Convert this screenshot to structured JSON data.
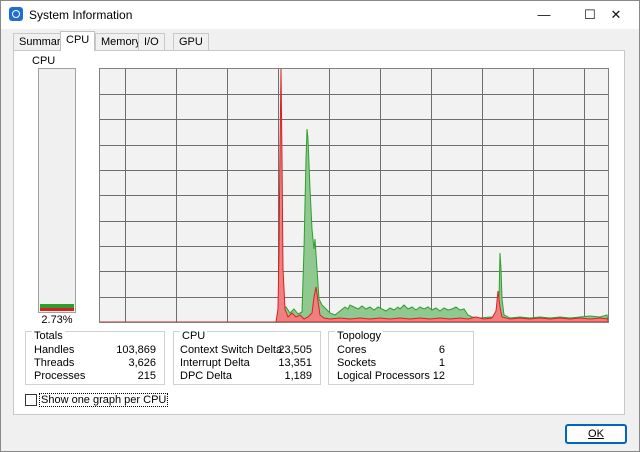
{
  "window": {
    "title": "System Information",
    "controls": {
      "minimize": "—",
      "maximize": "☐",
      "close": "✕"
    }
  },
  "tabs": [
    {
      "label": "Summary",
      "active": false
    },
    {
      "label": "CPU",
      "active": true
    },
    {
      "label": "Memory",
      "active": false
    },
    {
      "label": "I/O",
      "active": false
    },
    {
      "label": "GPU",
      "active": false
    }
  ],
  "cpu_meter": {
    "label": "CPU",
    "value_text": "2.73%",
    "value_fraction": 0.0273
  },
  "totals": {
    "title": "Totals",
    "rows": [
      {
        "label": "Handles",
        "value": "103,869"
      },
      {
        "label": "Threads",
        "value": "3,626"
      },
      {
        "label": "Processes",
        "value": "215"
      }
    ]
  },
  "cpu_stats": {
    "title": "CPU",
    "rows": [
      {
        "label": "Context Switch Delta",
        "value": "23,505"
      },
      {
        "label": "Interrupt Delta",
        "value": "13,351"
      },
      {
        "label": "DPC Delta",
        "value": "1,189"
      }
    ]
  },
  "topology": {
    "title": "Topology",
    "rows": [
      {
        "label": "Cores",
        "value": "6"
      },
      {
        "label": "Sockets",
        "value": "1"
      },
      {
        "label": "Logical Processors",
        "value": "12"
      }
    ]
  },
  "checkbox": {
    "label": "Show one graph per CPU",
    "checked": false
  },
  "ok_button": {
    "label": "OK"
  },
  "colors": {
    "total_series": "#2e9e2e",
    "kernel_series": "#d92020",
    "accent": "#0067c0"
  }
}
